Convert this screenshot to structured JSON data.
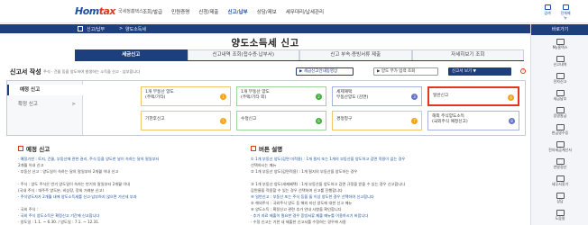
{
  "header": {
    "logo_main": "Hom",
    "logo_accent": "tax",
    "logo_sub": "국세청홈택스",
    "nav": [
      "조회/발급",
      "민원증명",
      "신청/제출",
      "신고/납부",
      "상담/제보",
      "세무대리/납세관리"
    ],
    "active_nav": 3,
    "util": [
      "검색",
      "전체메뉴"
    ]
  },
  "breadcrumb": [
    "신고/납부",
    "양도소득세"
  ],
  "page_title": "양도소득세 신고",
  "tabs": [
    "세금신고",
    "신고내역 조회(접수증·납부서)",
    "신고 부속·증빙서류 제출",
    "자세히보기 조회"
  ],
  "active_tab": 0,
  "section": {
    "title": "신고서 작성",
    "description": "주식 · 건물 등을 양도하여 발생하는 소득을 신고 · 납부합니다",
    "btn_video": "▶ 세금신고안내동영상",
    "btn_register": "▶ 양도 부가 입력 조회",
    "btn_view": "신고서 보기 ▼",
    "help": "?"
  },
  "side_menu": [
    {
      "label": "예정 신고",
      "arrow": ""
    },
    {
      "label": "확정 신고",
      "arrow": ">"
    }
  ],
  "cards": [
    {
      "line1": "1개 부동산 양도",
      "line2": "(주택/기타)",
      "num": "1",
      "color": "orange"
    },
    {
      "line1": "1개 부동산 양도",
      "line2": "(주택/기타 외)",
      "num": "2",
      "color": "green"
    },
    {
      "line1": "세제혜택",
      "line2": "부동산양도 (감면)",
      "num": "3",
      "color": "blue"
    },
    {
      "line1": "일반신고",
      "line2": "",
      "num": "4",
      "color": "orange"
    },
    {
      "line1": "기한후신고",
      "line2": "",
      "num": "5",
      "color": "orange"
    },
    {
      "line1": "수정신고",
      "line2": "",
      "num": "6",
      "color": "green"
    },
    {
      "line1": "경정청구",
      "line2": "",
      "num": "7",
      "color": "orange"
    },
    {
      "line1": "해외 주식양도소득",
      "line2": "(국외주식 예정신고)",
      "num": "8",
      "color": "blue"
    }
  ],
  "left_info": {
    "title": "예정 신고",
    "lines": [
      "· 예정기한 : 토지, 건물, 부동산에 관한 권리, 주식 등을 양도한 날이 속하는 달의 말일부터",
      "  2개월 이내 신고",
      "· 부동산 신고 : 양도일이 속하는 달의 말일부터 2개월 이내 신고",
      "",
      "· 주식 : 양도 주식은 반기 양도일이 속하는 반기의 말일부터 2개월 이내",
      "  (국내 주식 : 대주주 양도분, 비상장, 장외 거래분 신고)",
      "  · 주식양도자가 2개월 내에 양도소득세를 신고·납부하지 않으면 가산세 부과",
      "",
      "· 국외 주식 :",
      "  · 국외 주식 양도소득은 확정신고 기간에 신고합니다",
      "  · 양도일 : 1.1. ~ 6.30. / 양도일 : 7.1. ~ 12.31."
    ]
  },
  "right_info": {
    "title": "버튼 설명",
    "lines": [
      "① 1개 부동산 양도(감면 미적용) : 1개 필지 또는 1개의 부동산을 양도하고 감면 적용이 없는 경우",
      "    선택하시는 메뉴",
      "② 1개 부동산 양도(감면적용) : 1개 필지의 부동산을 양도하는 경우",
      "",
      "③ 1개 부동산 양도(세제혜택) : 1개 부동산을 양도하고 감면 규정을 받을 수 있는 경우 신고합니다",
      "    감면율을 적용할 수 있는 경우 선택하여 신고를 진행합니다",
      "④ 일반신고 : 부동산 또는 주식 등을 둘 이상 양도한 경우 선택하여 신고합니다",
      "⑤ 해외주식 : 국외주식 양도 등 해외 자산 양도에 대한 신고 메뉴",
      "⑥ 양도소득 : 확정신고 관련 추가 안내 사항을 확인합니다",
      "    · 추가 자료 제출이 필요한 경우 증빙서류 제출 메뉴를 이용하시기 바랍니다",
      "    · 수정 신고는 기한 내 제출한 신고서를 수정하는 경우에 사용"
    ]
  },
  "quick_menu": {
    "title": "바로가기",
    "items": [
      "My홈택스",
      "신고내역",
      "전자신고",
      "세금납부",
      "증명발급",
      "현금영수증",
      "전자세금계산서",
      "연말정산",
      "세무서찾기",
      "상담",
      "도움말"
    ]
  }
}
